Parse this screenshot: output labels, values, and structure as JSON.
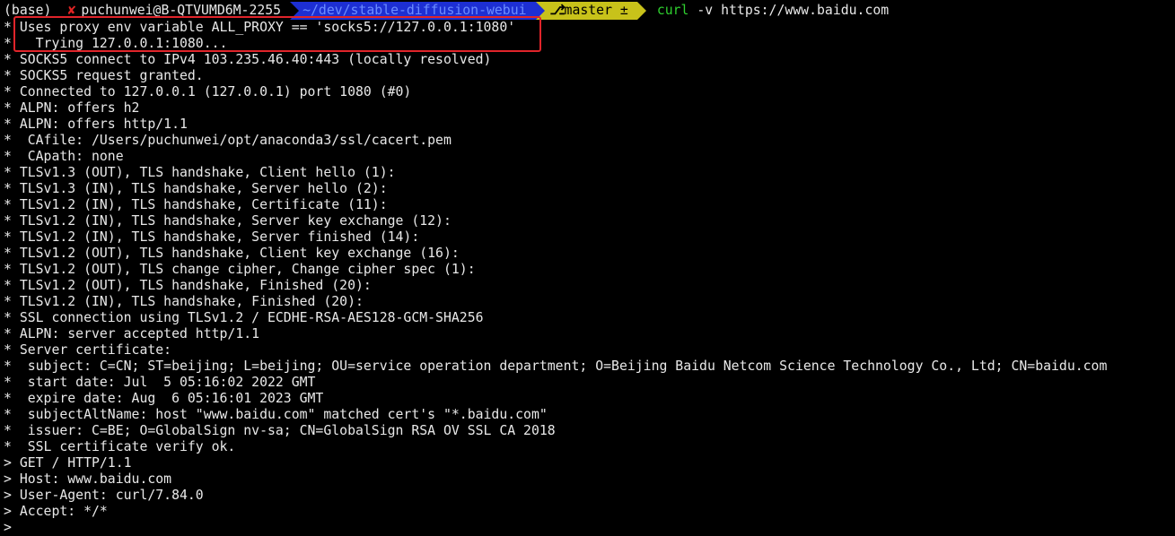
{
  "prompt": {
    "env": "(base)",
    "status_icon": "✘",
    "user_host": "puchunwei@B-QTVUMD6M-2255",
    "directory": "~/dev/stable-diffusion-webui",
    "git_icon": "branch-icon",
    "git_branch": "master ±",
    "command_name": "curl",
    "command_args": "-v https://www.baidu.com"
  },
  "colors": {
    "background": "#000000",
    "status_red": "#e02424",
    "dir_bg": "#1d2fd3",
    "git_bg": "#c8c21a",
    "command_green": "#2fd02f",
    "highlight_red": "#e0242a"
  },
  "output_lines": [
    "* Uses proxy env variable ALL_PROXY == 'socks5://127.0.0.1:1080'",
    "*   Trying 127.0.0.1:1080...",
    "* SOCKS5 connect to IPv4 103.235.46.40:443 (locally resolved)",
    "* SOCKS5 request granted.",
    "* Connected to 127.0.0.1 (127.0.0.1) port 1080 (#0)",
    "* ALPN: offers h2",
    "* ALPN: offers http/1.1",
    "*  CAfile: /Users/puchunwei/opt/anaconda3/ssl/cacert.pem",
    "*  CApath: none",
    "* TLSv1.3 (OUT), TLS handshake, Client hello (1):",
    "* TLSv1.3 (IN), TLS handshake, Server hello (2):",
    "* TLSv1.2 (IN), TLS handshake, Certificate (11):",
    "* TLSv1.2 (IN), TLS handshake, Server key exchange (12):",
    "* TLSv1.2 (IN), TLS handshake, Server finished (14):",
    "* TLSv1.2 (OUT), TLS handshake, Client key exchange (16):",
    "* TLSv1.2 (OUT), TLS change cipher, Change cipher spec (1):",
    "* TLSv1.2 (OUT), TLS handshake, Finished (20):",
    "* TLSv1.2 (IN), TLS handshake, Finished (20):",
    "* SSL connection using TLSv1.2 / ECDHE-RSA-AES128-GCM-SHA256",
    "* ALPN: server accepted http/1.1",
    "* Server certificate:",
    "*  subject: C=CN; ST=beijing; L=beijing; OU=service operation department; O=Beijing Baidu Netcom Science Technology Co., Ltd; CN=baidu.com",
    "*  start date: Jul  5 05:16:02 2022 GMT",
    "*  expire date: Aug  6 05:16:01 2023 GMT",
    "*  subjectAltName: host \"www.baidu.com\" matched cert's \"*.baidu.com\"",
    "*  issuer: C=BE; O=GlobalSign nv-sa; CN=GlobalSign RSA OV SSL CA 2018",
    "*  SSL certificate verify ok.",
    "> GET / HTTP/1.1",
    "> Host: www.baidu.com",
    "> User-Agent: curl/7.84.0",
    "> Accept: */*",
    ">"
  ]
}
